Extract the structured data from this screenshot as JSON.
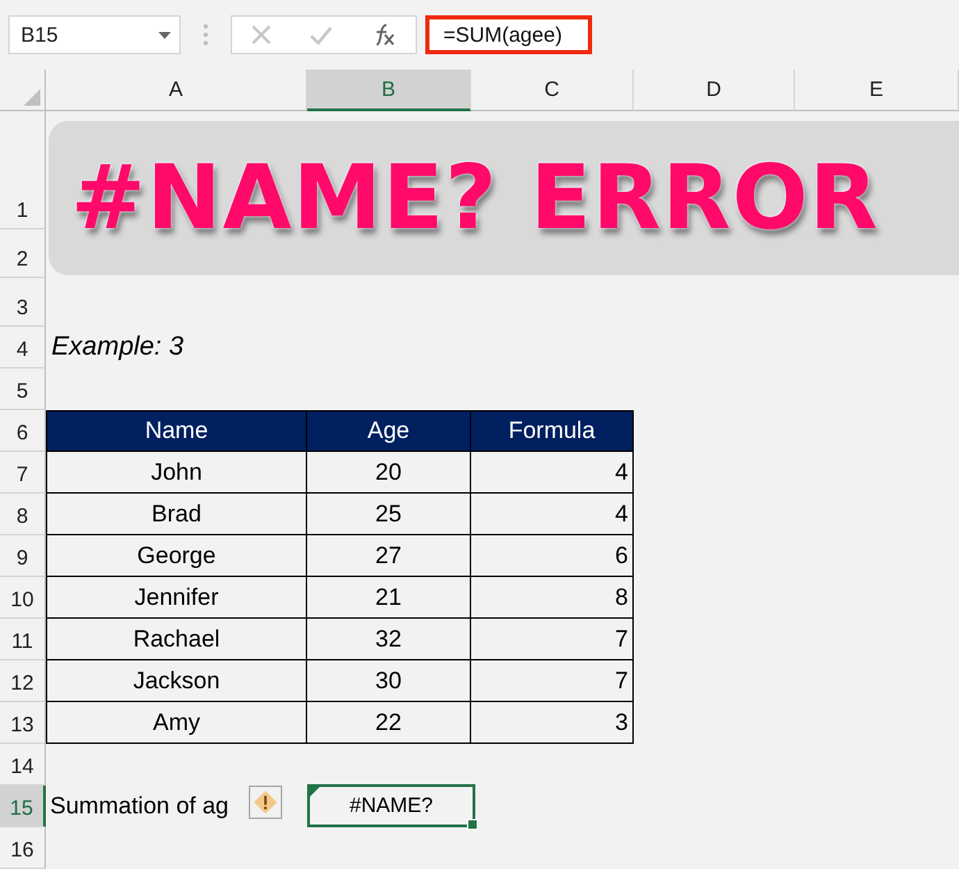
{
  "formula_bar": {
    "name_box": "B15",
    "formula": "=SUM(agee)"
  },
  "column_headers": [
    {
      "label": "A",
      "selected": false
    },
    {
      "label": "B",
      "selected": true
    },
    {
      "label": "C",
      "selected": false
    },
    {
      "label": "D",
      "selected": false
    },
    {
      "label": "E",
      "selected": false
    }
  ],
  "row_headers": [
    {
      "label": "1",
      "selected": false
    },
    {
      "label": "2",
      "selected": false
    },
    {
      "label": "3",
      "selected": false
    },
    {
      "label": "4",
      "selected": false
    },
    {
      "label": "5",
      "selected": false
    },
    {
      "label": "6",
      "selected": false
    },
    {
      "label": "7",
      "selected": false
    },
    {
      "label": "8",
      "selected": false
    },
    {
      "label": "9",
      "selected": false
    },
    {
      "label": "10",
      "selected": false
    },
    {
      "label": "11",
      "selected": false
    },
    {
      "label": "12",
      "selected": false
    },
    {
      "label": "13",
      "selected": false
    },
    {
      "label": "14",
      "selected": false
    },
    {
      "label": "15",
      "selected": true
    },
    {
      "label": "16",
      "selected": false
    }
  ],
  "banner": {
    "title": "#NAME? ERROR"
  },
  "example": "Example: 3",
  "table": {
    "columns": [
      "Name",
      "Age",
      "Formula"
    ],
    "rows": [
      [
        "John",
        "20",
        "4"
      ],
      [
        "Brad",
        "25",
        "4"
      ],
      [
        "George",
        "27",
        "6"
      ],
      [
        "Jennifer",
        "21",
        "8"
      ],
      [
        "Rachael",
        "32",
        "7"
      ],
      [
        "Jackson",
        "30",
        "7"
      ],
      [
        "Amy",
        "22",
        "3"
      ]
    ]
  },
  "summary": {
    "label": "Summation of ag",
    "value": "#NAME?"
  }
}
